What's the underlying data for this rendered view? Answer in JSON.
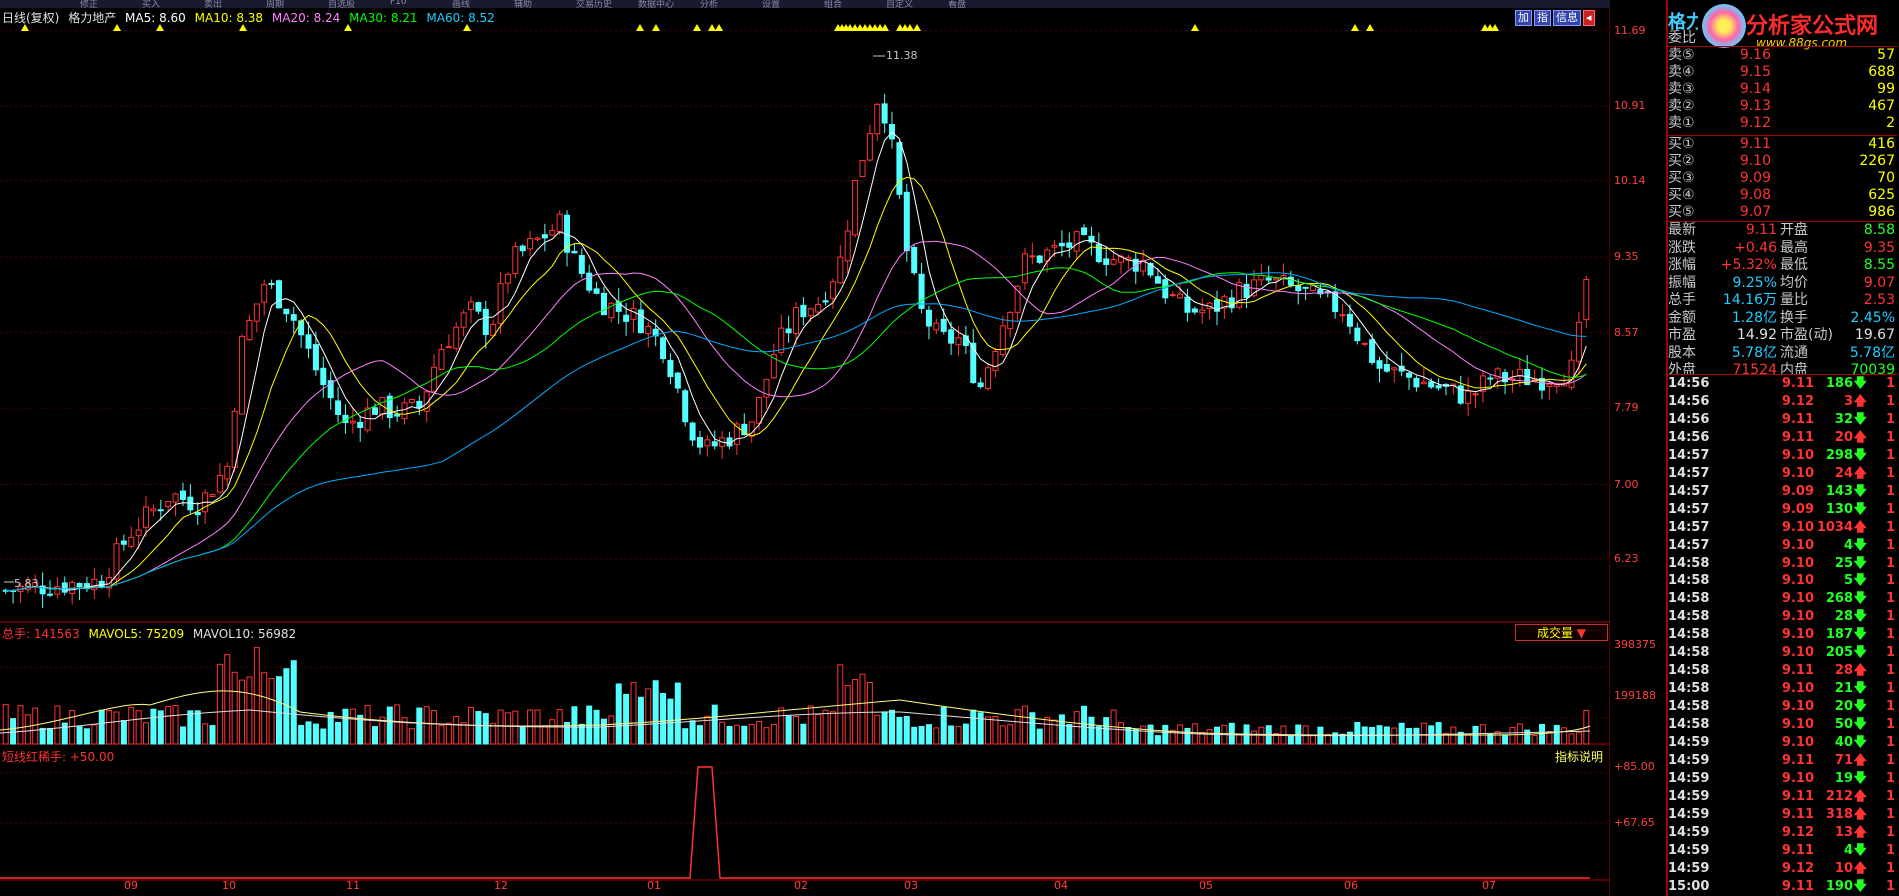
{
  "toolbar": {
    "items": [
      "修正",
      "买入",
      "卖出",
      "周期",
      "自选股",
      "F10",
      "画线",
      "辅助",
      "交易历史",
      "数据中心",
      "分析",
      "设置",
      "组合",
      "自定义",
      "看盘"
    ]
  },
  "header": {
    "period": "日线(复权)",
    "stock_name": "格力地产",
    "ma5": "MA5: 8.60",
    "ma10": "MA10: 8.38",
    "ma20": "MA20: 8.24",
    "ma30": "MA30: 8.21",
    "ma60": "MA60: 8.52"
  },
  "top_buttons": [
    "加",
    "指",
    "信息"
  ],
  "y_axis_labels": [
    "11.69",
    "10.91",
    "10.14",
    "9.35",
    "8.57",
    "7.79",
    "7.00",
    "6.23"
  ],
  "x_axis_labels": [
    "09",
    "10",
    "11",
    "12",
    "01",
    "02",
    "03",
    "04",
    "05",
    "06",
    "07"
  ],
  "high_label": "11.38",
  "low_label": "5.83",
  "volume_header": {
    "total": "总手: 141563",
    "mavol5": "MAVOL5: 75209",
    "mavol10": "MAVOL10: 56982"
  },
  "volume_selector": "成交量",
  "volume_axis_labels": [
    "398375",
    "199188"
  ],
  "indicator_header": "短线红稀手: +50.00",
  "indicator_help": "指标说明",
  "indicator_axis_labels": [
    "+85.00",
    "+67.65"
  ],
  "chart_data": {
    "type": "candlestick",
    "price_range": [
      5.6,
      11.8
    ],
    "ma_current": {
      "MA5": 8.6,
      "MA10": 8.38,
      "MA20": 8.24,
      "MA30": 8.21,
      "MA60": 8.52
    },
    "colors": {
      "up": "#ff3333",
      "down": "#54ffff",
      "ma5": "#ffffff",
      "ma10": "#ffff00",
      "ma20": "#ff80ff",
      "ma30": "#00ff00",
      "ma60": "#00aaff"
    }
  },
  "right_panel": {
    "title": "格力",
    "logo_text": "分析家公式网",
    "logo_url": "www.88gs.com",
    "weibi_label": "委比",
    "asks": [
      {
        "label": "卖⑤",
        "price": "9.16",
        "vol": "57"
      },
      {
        "label": "卖④",
        "price": "9.15",
        "vol": "688"
      },
      {
        "label": "卖③",
        "price": "9.14",
        "vol": "99"
      },
      {
        "label": "卖②",
        "price": "9.13",
        "vol": "467"
      },
      {
        "label": "卖①",
        "price": "9.12",
        "vol": "2"
      }
    ],
    "bids": [
      {
        "label": "买①",
        "price": "9.11",
        "vol": "416"
      },
      {
        "label": "买②",
        "price": "9.10",
        "vol": "2267"
      },
      {
        "label": "买③",
        "price": "9.09",
        "vol": "70"
      },
      {
        "label": "买④",
        "price": "9.08",
        "vol": "625"
      },
      {
        "label": "买⑤",
        "price": "9.07",
        "vol": "986"
      }
    ],
    "quote": [
      {
        "l1": "最新",
        "v1": "9.11",
        "c1": "red",
        "l2": "开盘",
        "v2": "8.58",
        "c2": "grn"
      },
      {
        "l1": "涨跌",
        "v1": "+0.46",
        "c1": "red",
        "l2": "最高",
        "v2": "9.35",
        "c2": "red"
      },
      {
        "l1": "涨幅",
        "v1": "+5.32%",
        "c1": "red",
        "l2": "最低",
        "v2": "8.55",
        "c2": "grn"
      },
      {
        "l1": "振幅",
        "v1": "9.25%",
        "c1": "cyn",
        "l2": "均价",
        "v2": "9.07",
        "c2": "red"
      },
      {
        "l1": "总手",
        "v1": "14.16万",
        "c1": "cyn",
        "l2": "量比",
        "v2": "2.53",
        "c2": "red"
      },
      {
        "l1": "金额",
        "v1": "1.28亿",
        "c1": "cyn",
        "l2": "换手",
        "v2": "2.45%",
        "c2": "cyn"
      },
      {
        "l1": "市盈",
        "v1": "14.92",
        "c1": "wht",
        "l2": "市盈(动)",
        "v2": "19.67",
        "c2": "wht"
      },
      {
        "l1": "股本",
        "v1": "5.78亿",
        "c1": "cyn",
        "l2": "流通",
        "v2": "5.78亿",
        "c2": "cyn"
      },
      {
        "l1": "外盘",
        "v1": "71524",
        "c1": "red",
        "l2": "内盘",
        "v2": "70039",
        "c2": "grn"
      }
    ],
    "ticks": [
      {
        "t": "14:56",
        "p": "9.11",
        "pc": "red",
        "v": "186",
        "d": "down"
      },
      {
        "t": "14:56",
        "p": "9.12",
        "pc": "red",
        "v": "3",
        "d": "up"
      },
      {
        "t": "14:56",
        "p": "9.11",
        "pc": "red",
        "v": "32",
        "d": "down"
      },
      {
        "t": "14:56",
        "p": "9.11",
        "pc": "red",
        "v": "20",
        "d": "up"
      },
      {
        "t": "14:57",
        "p": "9.10",
        "pc": "red",
        "v": "298",
        "d": "down"
      },
      {
        "t": "14:57",
        "p": "9.10",
        "pc": "red",
        "v": "24",
        "d": "up"
      },
      {
        "t": "14:57",
        "p": "9.09",
        "pc": "red",
        "v": "143",
        "d": "down"
      },
      {
        "t": "14:57",
        "p": "9.09",
        "pc": "red",
        "v": "130",
        "d": "down"
      },
      {
        "t": "14:57",
        "p": "9.10",
        "pc": "red",
        "v": "1034",
        "d": "up"
      },
      {
        "t": "14:57",
        "p": "9.10",
        "pc": "red",
        "v": "4",
        "d": "down"
      },
      {
        "t": "14:58",
        "p": "9.10",
        "pc": "red",
        "v": "25",
        "d": "down"
      },
      {
        "t": "14:58",
        "p": "9.10",
        "pc": "red",
        "v": "5",
        "d": "down"
      },
      {
        "t": "14:58",
        "p": "9.10",
        "pc": "red",
        "v": "268",
        "d": "down"
      },
      {
        "t": "14:58",
        "p": "9.10",
        "pc": "red",
        "v": "28",
        "d": "down"
      },
      {
        "t": "14:58",
        "p": "9.10",
        "pc": "red",
        "v": "187",
        "d": "down"
      },
      {
        "t": "14:58",
        "p": "9.10",
        "pc": "red",
        "v": "205",
        "d": "down"
      },
      {
        "t": "14:58",
        "p": "9.11",
        "pc": "red",
        "v": "28",
        "d": "up"
      },
      {
        "t": "14:58",
        "p": "9.10",
        "pc": "red",
        "v": "21",
        "d": "down"
      },
      {
        "t": "14:58",
        "p": "9.10",
        "pc": "red",
        "v": "20",
        "d": "down"
      },
      {
        "t": "14:58",
        "p": "9.10",
        "pc": "red",
        "v": "50",
        "d": "down"
      },
      {
        "t": "14:59",
        "p": "9.10",
        "pc": "red",
        "v": "40",
        "d": "down"
      },
      {
        "t": "14:59",
        "p": "9.11",
        "pc": "red",
        "v": "71",
        "d": "up"
      },
      {
        "t": "14:59",
        "p": "9.10",
        "pc": "red",
        "v": "19",
        "d": "down"
      },
      {
        "t": "14:59",
        "p": "9.11",
        "pc": "red",
        "v": "212",
        "d": "up"
      },
      {
        "t": "14:59",
        "p": "9.11",
        "pc": "red",
        "v": "318",
        "d": "up"
      },
      {
        "t": "14:59",
        "p": "9.12",
        "pc": "red",
        "v": "13",
        "d": "up"
      },
      {
        "t": "14:59",
        "p": "9.11",
        "pc": "red",
        "v": "4",
        "d": "down"
      },
      {
        "t": "14:59",
        "p": "9.12",
        "pc": "red",
        "v": "10",
        "d": "up"
      },
      {
        "t": "15:00",
        "p": "9.11",
        "pc": "red",
        "v": "190",
        "d": "down"
      }
    ],
    "tick_count_label": "1"
  }
}
